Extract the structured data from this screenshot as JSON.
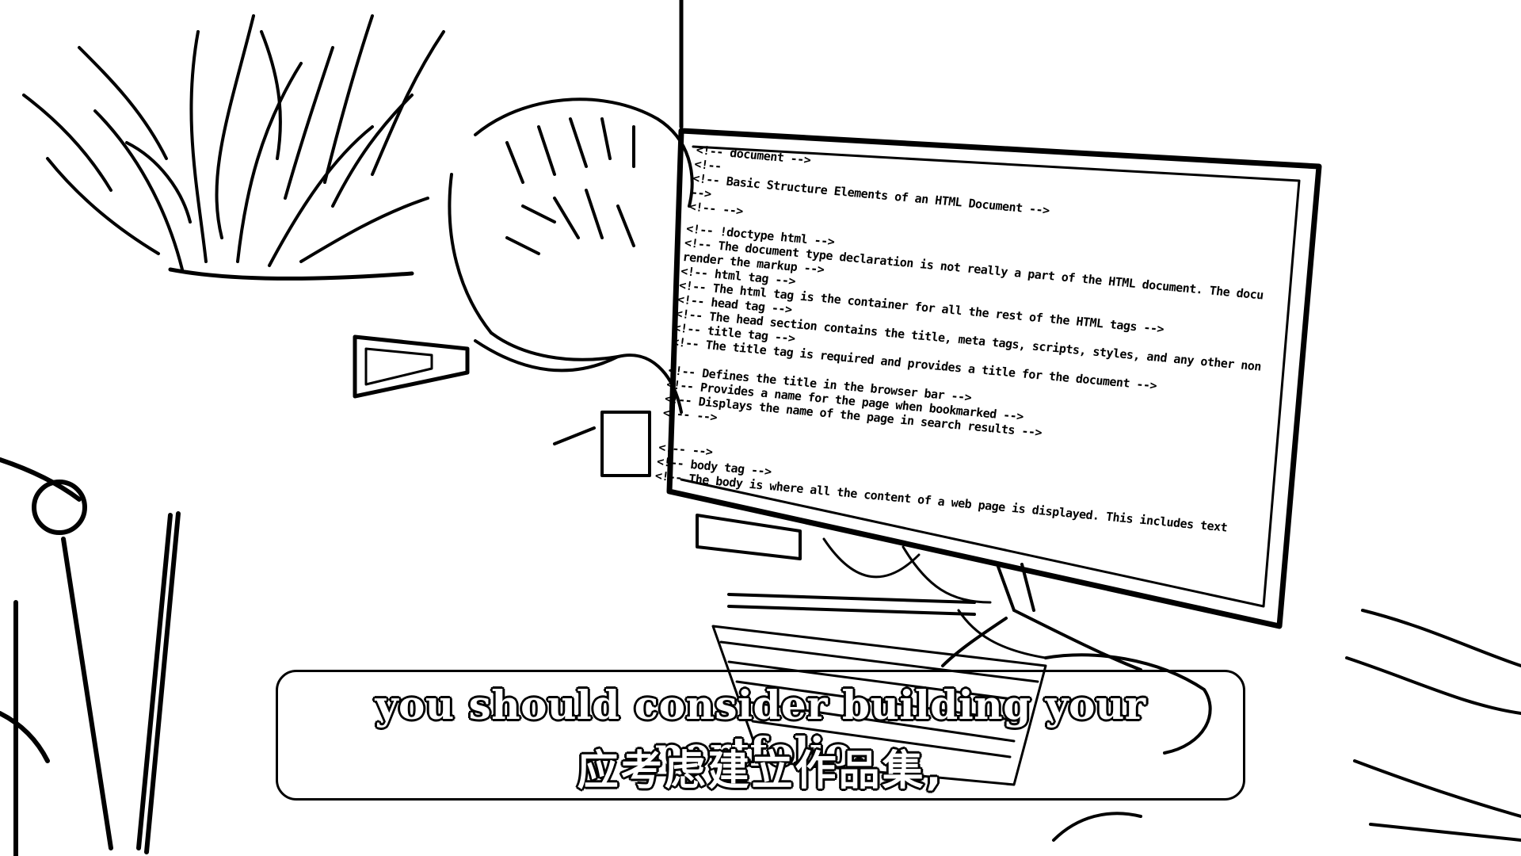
{
  "subtitle": {
    "english": "you should consider building your portfolio,",
    "chinese": "应考虑建立作品集,"
  },
  "monitor": {
    "code_lines": [
      "<!-- document -->",
      "<!--",
      "  <!-- Basic Structure Elements of an HTML Document -->",
      "-->",
      "<!-- -->",
      "    <!-- !doctype html -->",
      "<!-- The document type declaration is not really a part of the HTML document. The docu",
      "render the markup -->",
      "  <!-- html tag -->",
      "  <!-- The html tag is the container for all the rest of the HTML tags -->",
      "    <!-- head tag -->",
      "  <!-- The head section contains the title, meta tags, scripts, styles, and any other non",
      "    <!-- title tag -->",
      "  <!-- The title tag is required and provides a title for the document -->",
      "",
      "    <!-- Defines the title in the browser bar -->",
      "    <!-- Provides a name for the page when bookmarked -->",
      "    <!-- Displays the name of the page in search results -->",
      "    <!-- -->",
      "",
      "  <!-- -->",
      "    <!-- body tag -->",
      "  <!-- The body is where all the content of a web page is displayed. This includes text"
    ]
  },
  "colors": {
    "ink": "#000000",
    "paper": "#ffffff",
    "subtitle_fill": "#ffffff"
  }
}
